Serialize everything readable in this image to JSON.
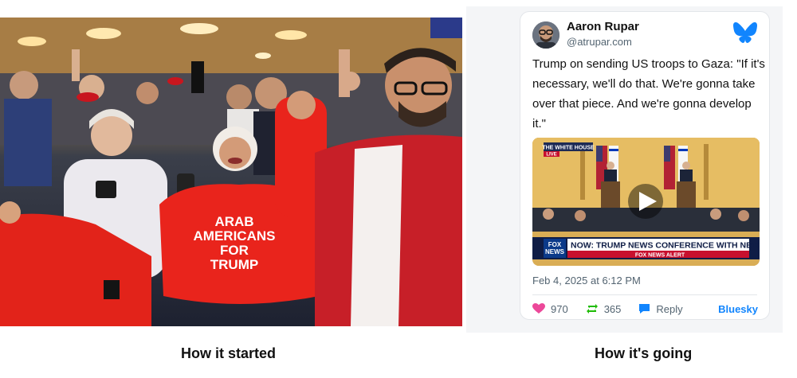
{
  "left_panel": {
    "caption": "How it started",
    "photo": {
      "shirt_text_lines": [
        "ARAB",
        "AMERICANS",
        "FOR",
        "TRUMP"
      ]
    }
  },
  "right_panel": {
    "caption": "How it's going",
    "post": {
      "author_name": "Aaron Rupar",
      "author_handle": "@atrupar.com",
      "text": "Trump on sending US troops to Gaza: \"If it's necessary, we'll do that. We're gonna take over that piece. And we're gonna develop it.\"",
      "video": {
        "network_bug": "THE WHITE HOUSE",
        "live_label": "LIVE",
        "channel_logo_lines": [
          "FOX",
          "NEWS"
        ],
        "headline": "NOW: TRUMP NEWS CONFERENCE WITH NETANYAHU",
        "alert": "FOX NEWS ALERT"
      },
      "timestamp": "Feb 4, 2025 at 6:12 PM",
      "likes": "970",
      "reposts": "365",
      "reply_label": "Reply",
      "platform": "Bluesky",
      "colors": {
        "like": "#ec4899",
        "repost": "#20bc07",
        "reply": "#1185fe",
        "brand": "#1185fe"
      }
    }
  }
}
